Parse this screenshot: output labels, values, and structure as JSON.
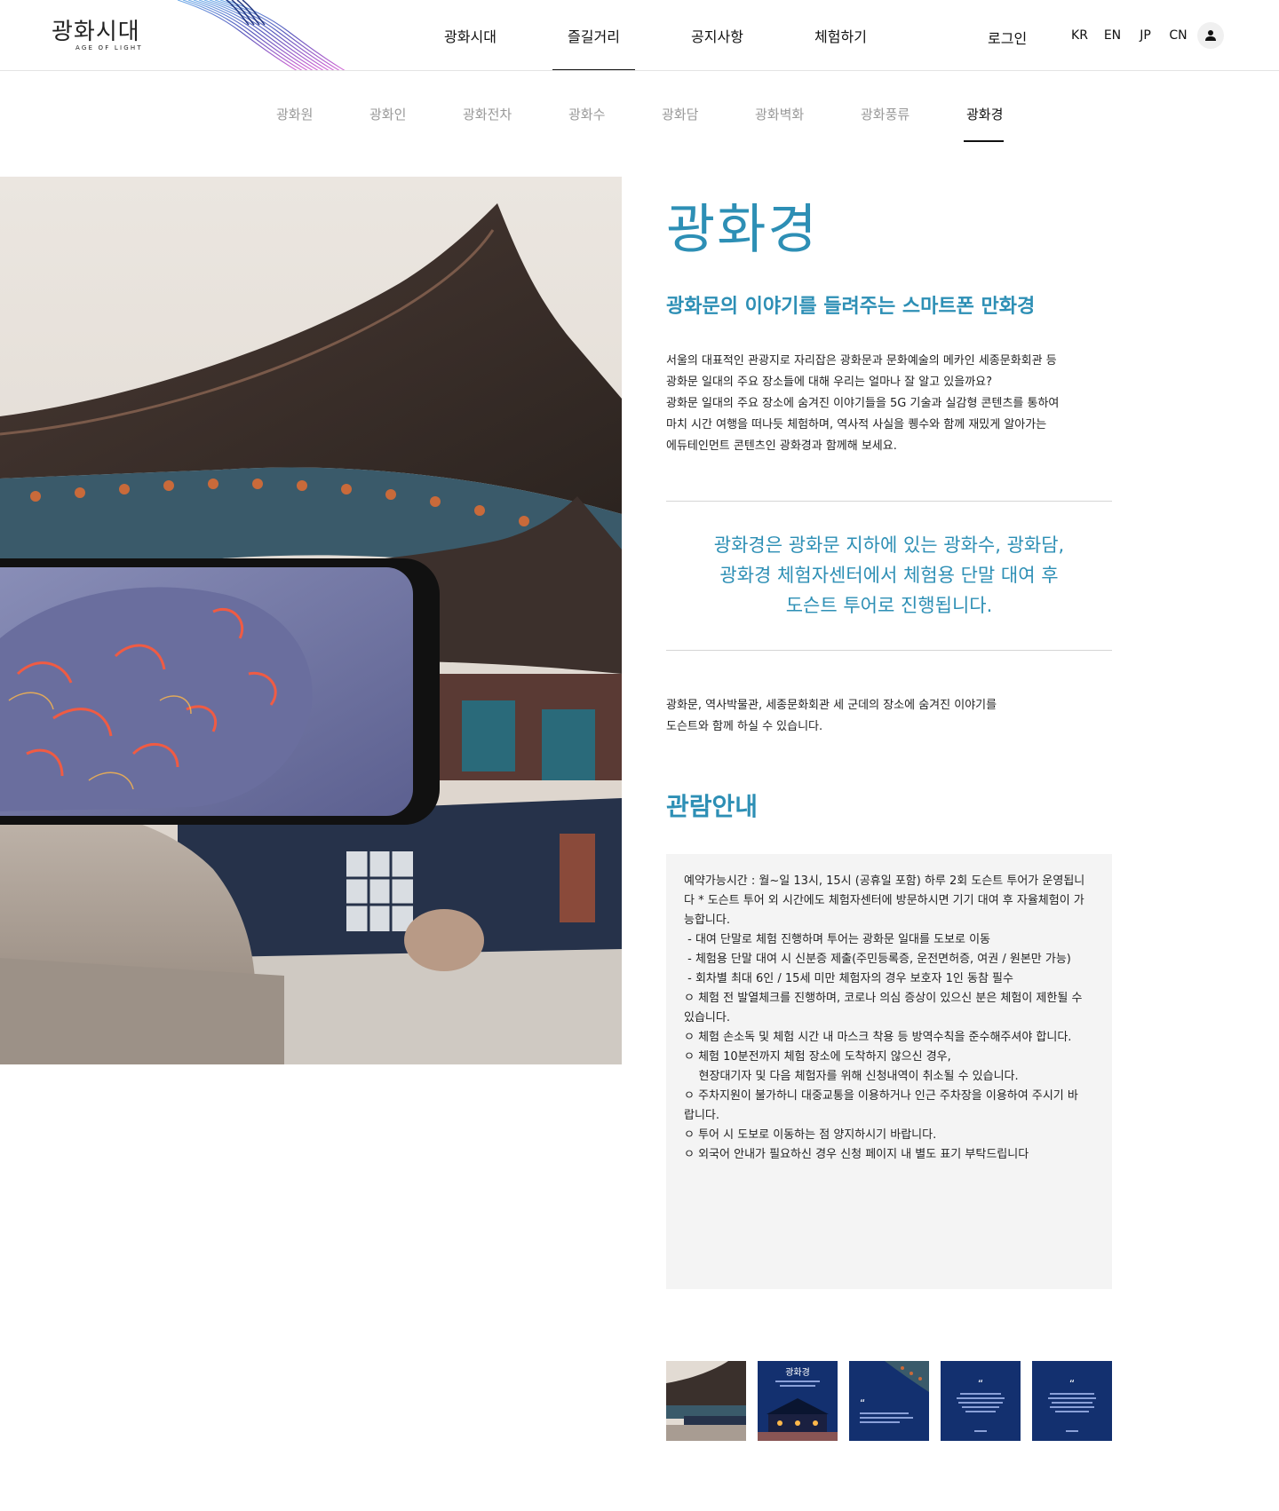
{
  "header": {
    "logo_ko": "광화시대",
    "logo_en": "AGE OF LIGHT",
    "nav": [
      "광화시대",
      "즐길거리",
      "공지사항",
      "체험하기"
    ],
    "active_nav_index": 1,
    "login": "로그인",
    "langs": [
      "KR",
      "EN",
      "JP",
      "CN"
    ]
  },
  "subnav": {
    "items": [
      "광화원",
      "광화인",
      "광화전차",
      "광화수",
      "광화담",
      "광화벽화",
      "광화풍류",
      "광화경"
    ],
    "active_index": 7
  },
  "main": {
    "title": "광화경",
    "subtitle": "광화문의 이야기를 들려주는 스마트폰 만화경",
    "intro": [
      "서울의 대표적인 관광지로 자리잡은 광화문과 문화예술의 메카인 세종문화회관 등",
      "광화문 일대의 주요 장소들에 대해 우리는 얼마나 잘 알고 있을까요?",
      "광화문 일대의 주요 장소에 숨겨진 이야기들을 5G 기술과 실감형 콘텐츠를 통하여",
      "마치 시간 여행을 떠나듯 체험하며, 역사적 사실을 퀭수와 함께 재밌게 알아가는",
      "에듀테인먼트 콘텐츠인 광화경과 함께해 보세요."
    ],
    "highlight": [
      "광화경은 광화문 지하에 있는 광화수, 광화담,",
      "광화경 체험자센터에서 체험용 단말 대여 후",
      "도슨트 투어로 진행됩니다."
    ],
    "desc": [
      "광화문, 역사박물관, 세종문화회관 세 군데의 장소에 숨겨진 이야기를",
      "도슨트와 함께 하실 수 있습니다."
    ],
    "section_title": "관람안내",
    "info": [
      "예약가능시간 : 월~일 13시, 15시 (공휴일 포함) 하루 2회 도슨트 투어가 운영됩니",
      "다 * 도슨트 투어 외 시간에도 체험자센터에 방문하시면 기기 대여 후 자율체험이 가",
      "능합니다.",
      "",
      " - 대여 단말로 체험 진행하며 투어는 광화문 일대를 도보로 이동",
      " - 체험용 단말 대여 시 신분증 제출(주민등록증, 운전면허증, 여권 / 원본만 가능)",
      " - 회차별 최대 6인 / 15세 미만 체험자의 경우 보호자 1인 동참 필수",
      "",
      "",
      "ㅇ 체험 전 발열체크를 진행하며, 코로나 의심 증상이 있으신 분은 체험이 제한될 수",
      "있습니다.",
      "ㅇ 체험 손소독 및 체험 시간 내 마스크 착용 등 방역수칙을 준수해주셔야 합니다.",
      "ㅇ 체험 10분전까지 체험 장소에 도착하지 않으신 경우,",
      "    현장대기자 및 다음 체험자를 위해 신청내역이 취소될 수 있습니다.",
      "ㅇ 주차지원이 불가하니 대중교통을 이용하거나 인근 주차장을 이용하여 주시기 바",
      "랍니다.",
      "ㅇ 투어 시 도보로 이동하는 점 양지하시기 바랍니다.",
      "ㅇ 외국어 안내가 필요하신 경우 신청 페이지 내 별도 표기 부탁드립니다"
    ],
    "thumb_title": "광화경"
  },
  "colors": {
    "accent": "#2d8fb5",
    "info_bg": "#f4f4f4",
    "thumb_navy": "#13306f"
  }
}
